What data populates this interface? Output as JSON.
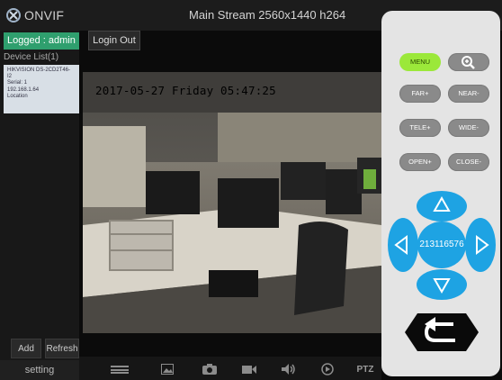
{
  "app": {
    "name": "ONVIF"
  },
  "header": {
    "stream_title": "Main Stream 2560x1440 h264"
  },
  "session": {
    "logged_label": "Logged : admin",
    "login_out_label": "Login Out"
  },
  "devices": {
    "list_label": "Device List(1)",
    "items": [
      {
        "line1": "HIKVISION DS-2CD2T46-",
        "line2": "I2",
        "line3": "Serial: 1",
        "line4": "192.168.1.64",
        "line5": "Location"
      }
    ],
    "add_label": "Add",
    "refresh_label": "Refresh"
  },
  "setting_label": "setting",
  "video": {
    "timestamp": "2017-05-27 Friday 05:47:25"
  },
  "toolbar": {
    "items": [
      "menu-icon",
      "image-icon",
      "camera-icon",
      "record-icon",
      "volume-icon",
      "play-icon"
    ],
    "ptz_label": "PTZ"
  },
  "ptz": {
    "menu_label": "MENU",
    "far_label": "FAR+",
    "near_label": "NEAR-",
    "tele_label": "TELE+",
    "wide_label": "WIDE-",
    "open_label": "OPEN+",
    "close_label": "CLOSE-",
    "center_value": "213116576",
    "accent_color": "#1ea3e3"
  }
}
